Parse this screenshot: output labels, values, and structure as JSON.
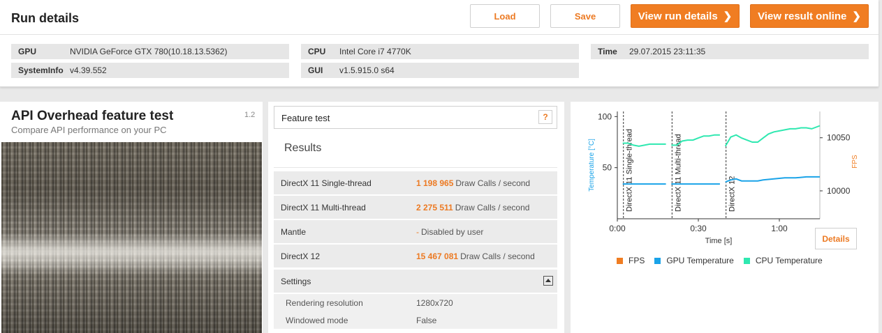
{
  "run": {
    "title": "Run details",
    "buttons": {
      "load": "Load",
      "save": "Save",
      "view_run": "View run details",
      "view_online": "View result online"
    },
    "info": [
      {
        "key": "GPU",
        "value": "NVIDIA GeForce GTX 780(10.18.13.5362)"
      },
      {
        "key": "SystemInfo",
        "value": "v4.39.552"
      },
      {
        "key": "CPU",
        "value": "Intel Core i7 4770K"
      },
      {
        "key": "GUI",
        "value": "v1.5.915.0 s64"
      },
      {
        "key": "Time",
        "value": "29.07.2015 23:11:35"
      }
    ]
  },
  "test": {
    "title": "API Overhead feature test",
    "subtitle": "Compare API performance on your PC",
    "version": "1.2"
  },
  "feature": {
    "label": "Feature test",
    "help": "?"
  },
  "results": {
    "heading": "Results",
    "rows": [
      {
        "name": "DirectX 11 Single-thread",
        "value": "1 198 965",
        "unit": "Draw Calls / second"
      },
      {
        "name": "DirectX 11 Multi-thread",
        "value": "2 275 511",
        "unit": "Draw Calls / second"
      },
      {
        "name": "Mantle",
        "value": "-",
        "unit": "Disabled by user"
      },
      {
        "name": "DirectX 12",
        "value": "15 467 081",
        "unit": "Draw Calls / second"
      }
    ]
  },
  "settings": {
    "heading": "Settings",
    "rows": [
      {
        "name": "Rendering resolution",
        "value": "1280x720"
      },
      {
        "name": "Windowed mode",
        "value": "False"
      }
    ]
  },
  "chart_data": {
    "type": "line",
    "xlabel": "Time [s]",
    "ylabel_left": "Temperature [°C]",
    "ylabel_right": "FPS",
    "x_ticks": [
      "0:00",
      "0:30",
      "1:00"
    ],
    "y_left_ticks": [
      50,
      100
    ],
    "y_right_ticks": [
      10000,
      10050
    ],
    "xlim": [
      0,
      75
    ],
    "ylim_left": [
      0,
      105
    ],
    "phases": [
      {
        "label": "DirectX 11 Single-thread",
        "start": 2
      },
      {
        "label": "DirectX 11 Multi-thread",
        "start": 20
      },
      {
        "label": "DirectX 12",
        "start": 40
      }
    ],
    "series": [
      {
        "name": "FPS",
        "color": "#f07d22",
        "x": [],
        "values": []
      },
      {
        "name": "GPU Temperature",
        "color": "#1aa3e8",
        "x": [
          2,
          4,
          8,
          12,
          16,
          18,
          20,
          24,
          28,
          32,
          36,
          38,
          40,
          42,
          44,
          46,
          50,
          52,
          54,
          58,
          62,
          66,
          70,
          75
        ],
        "values": [
          34,
          34,
          34,
          34,
          34,
          34,
          34,
          34,
          34,
          34,
          34,
          34,
          36,
          38,
          39,
          37,
          37,
          37,
          38,
          39,
          40,
          40,
          41,
          41
        ]
      },
      {
        "name": "CPU Temperature",
        "color": "#2fe8b0",
        "x": [
          2,
          4,
          6,
          8,
          10,
          12,
          14,
          16,
          18,
          20,
          22,
          24,
          26,
          28,
          30,
          32,
          34,
          36,
          38,
          40,
          42,
          44,
          46,
          48,
          50,
          52,
          54,
          56,
          58,
          60,
          62,
          64,
          66,
          68,
          70,
          72,
          75
        ],
        "values": [
          74,
          74,
          72,
          71,
          72,
          73,
          73,
          73,
          73,
          72,
          72,
          76,
          77,
          77,
          79,
          81,
          81,
          82,
          82,
          71,
          80,
          82,
          79,
          77,
          75,
          75,
          79,
          83,
          85,
          86,
          87,
          88,
          88,
          89,
          89,
          88,
          91
        ]
      }
    ],
    "legend": "bottom"
  },
  "details_label": "Details"
}
